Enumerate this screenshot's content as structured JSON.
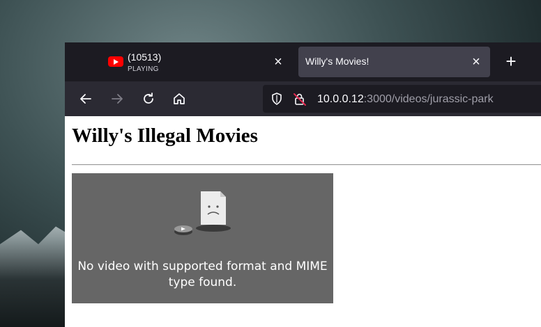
{
  "tabs": [
    {
      "title": "(10513)",
      "subtitle": "PLAYING",
      "icon": "youtube-icon",
      "active": false
    },
    {
      "title": "Willy's Movies!",
      "active": true
    }
  ],
  "navbar": {
    "url_host": "10.0.0.12",
    "url_rest": ":3000/videos/jurassic-park"
  },
  "page": {
    "heading": "Willy's Illegal Movies",
    "video_error": "No video with supported format and MIME type found."
  },
  "colors": {
    "tabbar_bg": "#1c1b22",
    "active_tab_bg": "#42414d",
    "navbar_bg": "#2b2a33",
    "video_bg": "#666666",
    "youtube_red": "#ff0000",
    "insecure_red": "#e22850"
  }
}
